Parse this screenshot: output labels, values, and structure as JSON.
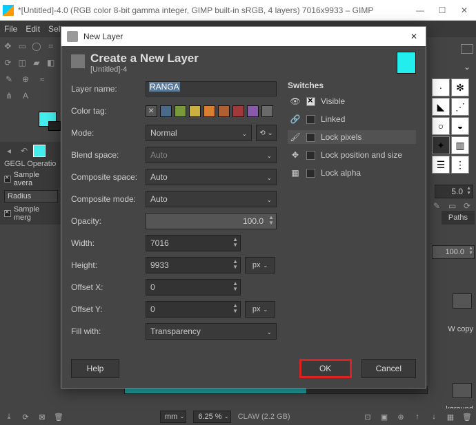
{
  "window": {
    "title": "*[Untitled]-4.0 (RGB color 8-bit gamma integer, GIMP built-in sRGB, 4 layers) 7016x9933 – GIMP"
  },
  "menubar": {
    "file": "File",
    "edit": "Edit",
    "select": "Sele"
  },
  "dialog": {
    "title": "New Layer",
    "heading": "Create a New Layer",
    "subheading": "[Untitled]-4",
    "fields": {
      "layer_name": {
        "label": "Layer name:",
        "value": "RANGA"
      },
      "color_tag": {
        "label": "Color tag:"
      },
      "mode": {
        "label": "Mode:",
        "value": "Normal"
      },
      "blend_space": {
        "label": "Blend space:",
        "value": "Auto"
      },
      "composite_space": {
        "label": "Composite space:",
        "value": "Auto"
      },
      "composite_mode": {
        "label": "Composite mode:",
        "value": "Auto"
      },
      "opacity": {
        "label": "Opacity:",
        "value": "100.0"
      },
      "width": {
        "label": "Width:",
        "value": "7016"
      },
      "height": {
        "label": "Height:",
        "value": "9933",
        "unit": "px"
      },
      "offset_x": {
        "label": "Offset X:",
        "value": "0"
      },
      "offset_y": {
        "label": "Offset Y:",
        "value": "0",
        "unit": "px"
      },
      "fill_with": {
        "label": "Fill with:",
        "value": "Transparency"
      }
    },
    "color_tags": [
      "none",
      "#4a6a8a",
      "#7a9a3a",
      "#c9b040",
      "#d88030",
      "#b06030",
      "#a03a3a",
      "#8a5aaa",
      "#6a6a6a"
    ],
    "switches": {
      "header": "Switches",
      "visible": {
        "label": "Visible",
        "checked": true
      },
      "linked": {
        "label": "Linked",
        "checked": false
      },
      "lock_pixels": {
        "label": "Lock pixels",
        "checked": false
      },
      "lock_position": {
        "label": "Lock position and size",
        "checked": false
      },
      "lock_alpha": {
        "label": "Lock alpha",
        "checked": false
      }
    },
    "buttons": {
      "help": "Help",
      "ok": "OK",
      "cancel": "Cancel"
    }
  },
  "tooloptions": {
    "title": "GEGL Operatio",
    "sample_avg": "Sample avera",
    "radius": "Radius",
    "sample_merged": "Sample merg"
  },
  "right_panels": {
    "spinner": "5.0",
    "paths": "Paths",
    "opacity": "100.0",
    "layer_copy": "W copy",
    "background": "kground"
  },
  "statusbar": {
    "unit": "mm",
    "zoom": "6.25 %",
    "info": "CLAW (2.2 GB)"
  }
}
